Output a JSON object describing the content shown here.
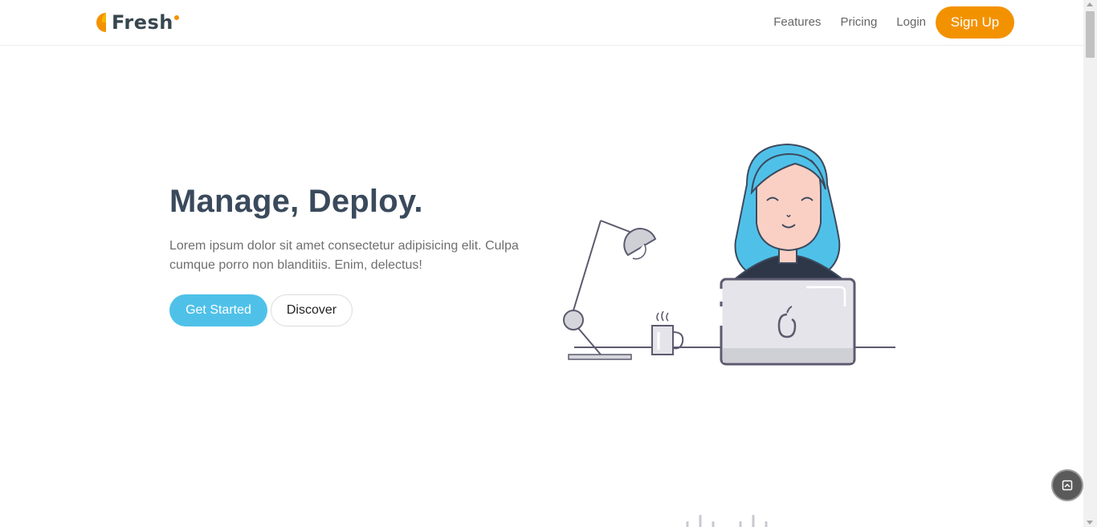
{
  "brand": {
    "name": "Fresh",
    "accent": "#f39200"
  },
  "nav": {
    "links": [
      "Features",
      "Pricing",
      "Login"
    ],
    "signup_label": "Sign Up"
  },
  "hero": {
    "title": "Manage, Deploy.",
    "subtitle": "Lorem ipsum dolor sit amet consectetur adipisicing elit. Culpa cumque porro non blanditiis. Enim, delectus!",
    "primary_label": "Get Started",
    "secondary_label": "Discover",
    "primary_color": "#4fc1e9"
  },
  "icons": {
    "back_to_top": "arrow-up-icon"
  }
}
